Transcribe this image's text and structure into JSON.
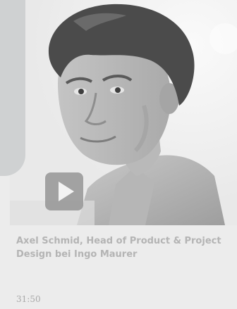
{
  "video": {
    "title": "Axel Schmid, Head of Product & Project Design bei Ingo Maurer",
    "duration": "31:50"
  },
  "icons": {
    "play": "play-icon"
  },
  "colors": {
    "card_background": "#ececec",
    "tab": "#cfd1d2",
    "caption_text": "#b4b4b4",
    "play_button": "#7d7d7d"
  }
}
